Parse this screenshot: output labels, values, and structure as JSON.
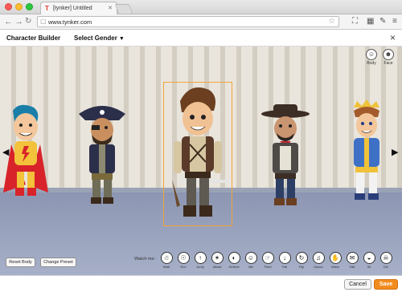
{
  "browser": {
    "tab_title": "[tynker] Untitled",
    "url": "www.tynker.com",
    "favicon": "tynker-logo-icon"
  },
  "app": {
    "title": "Character Builder",
    "gender_select": "Select Gender",
    "close": "×"
  },
  "stage": {
    "top_tools": [
      {
        "label": "Body",
        "icon": "body-icon",
        "glyph": "☺"
      },
      {
        "label": "Face",
        "icon": "face-icon",
        "glyph": "☻"
      }
    ],
    "buttons": {
      "reset": "Reset Body",
      "change_preset": "Change Preset"
    },
    "watch_label": "Watch me:",
    "actions": [
      {
        "label": "Walk",
        "glyph": "☃"
      },
      {
        "label": "Run",
        "glyph": "☉"
      },
      {
        "label": "Jump",
        "glyph": "↑"
      },
      {
        "label": "Attack",
        "glyph": "✶"
      },
      {
        "label": "Defend",
        "glyph": "◐"
      },
      {
        "label": "Idle",
        "glyph": "☺"
      },
      {
        "label": "Point",
        "glyph": "☞"
      },
      {
        "label": "Fall",
        "glyph": "↓"
      },
      {
        "label": "Flip",
        "glyph": "↻"
      },
      {
        "label": "Dance",
        "glyph": "♫"
      },
      {
        "label": "Wave",
        "glyph": "✋"
      },
      {
        "label": "Talk",
        "glyph": "✉"
      },
      {
        "label": "Sit",
        "glyph": "◒"
      },
      {
        "label": "Die",
        "glyph": "☠"
      }
    ]
  },
  "footer": {
    "cancel": "Cancel",
    "save": "Save"
  },
  "colors": {
    "accent": "#f28b1e",
    "selection": "#f2a33a"
  }
}
